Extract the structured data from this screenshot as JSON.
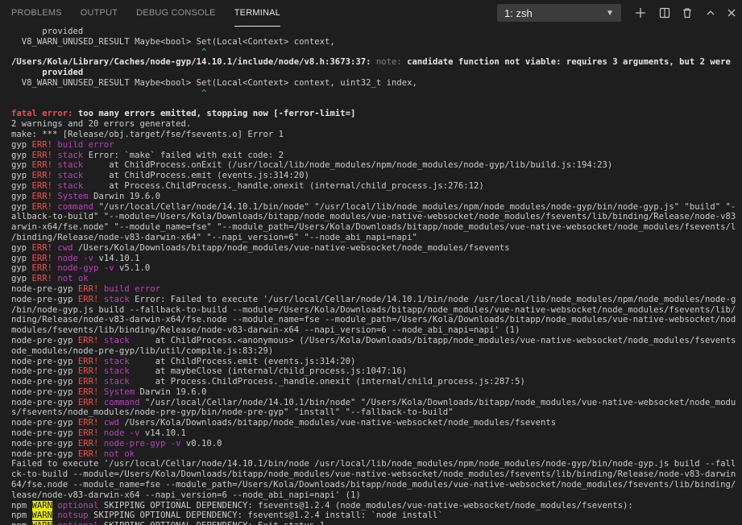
{
  "panel": {
    "tabs": [
      "PROBLEMS",
      "OUTPUT",
      "DEBUG CONSOLE",
      "TERMINAL"
    ],
    "active_tab": "TERMINAL",
    "terminal_select": "1: zsh",
    "icons": [
      "plus-icon",
      "split-icon",
      "trash-icon",
      "chevron-up-icon",
      "close-icon"
    ]
  },
  "terminal": {
    "lines": [
      [
        [
          "      provided"
        ]
      ],
      [
        [
          "  V8_WARN_UNUSED_RESULT Maybe<bool> Set(Local<Context> context,"
        ]
      ],
      [
        [
          "                                     ^",
          "grn"
        ]
      ],
      [
        [
          "/Users/Kola/Library/Caches/node-gyp/14.10.1/include/node/v8.h:3673:37: ",
          "b"
        ],
        [
          "note: ",
          "gry"
        ],
        [
          "candidate function not viable: requires 3 arguments, but 2 were",
          "b"
        ]
      ],
      [
        [
          "      provided",
          "b"
        ]
      ],
      [
        [
          "  V8_WARN_UNUSED_RESULT Maybe<bool> Set(Local<Context> context, uint32_t index,"
        ]
      ],
      [
        [
          "                                     ^",
          "grn"
        ]
      ],
      [
        [
          ""
        ]
      ],
      [
        [
          "fatal error: ",
          "red"
        ],
        [
          "too many errors emitted, stopping now [-ferror-limit=]",
          "b"
        ]
      ],
      [
        [
          "2 warnings and 20 errors generated."
        ]
      ],
      [
        [
          "make: *** [Release/obj.target/fse/fsevents.o] Error 1"
        ]
      ],
      [
        [
          "gyp "
        ],
        [
          "ERR!",
          "err"
        ],
        [
          " build error",
          "mag"
        ]
      ],
      [
        [
          "gyp "
        ],
        [
          "ERR!",
          "err"
        ],
        [
          " stack",
          "mag"
        ],
        [
          " Error: `make` failed with exit code: 2"
        ]
      ],
      [
        [
          "gyp "
        ],
        [
          "ERR!",
          "err"
        ],
        [
          " stack",
          "mag"
        ],
        [
          "     at ChildProcess.onExit (/usr/local/lib/node_modules/npm/node_modules/node-gyp/lib/build.js:194:23)"
        ]
      ],
      [
        [
          "gyp "
        ],
        [
          "ERR!",
          "err"
        ],
        [
          " stack",
          "mag"
        ],
        [
          "     at ChildProcess.emit (events.js:314:20)"
        ]
      ],
      [
        [
          "gyp "
        ],
        [
          "ERR!",
          "err"
        ],
        [
          " stack",
          "mag"
        ],
        [
          "     at Process.ChildProcess._handle.onexit (internal/child_process.js:276:12)"
        ]
      ],
      [
        [
          "gyp "
        ],
        [
          "ERR!",
          "err"
        ],
        [
          " System",
          "mag"
        ],
        [
          " Darwin 19.6.0"
        ]
      ],
      [
        [
          "gyp "
        ],
        [
          "ERR!",
          "err"
        ],
        [
          " command",
          "mag"
        ],
        [
          " \"/usr/local/Cellar/node/14.10.1/bin/node\" \"/usr/local/lib/node_modules/npm/node_modules/node-gyp/bin/node-gyp.js\" \"build\" \"--f"
        ]
      ],
      [
        [
          "allback-to-build\" \"--module=/Users/Kola/Downloads/bitapp/node_modules/vue-native-websocket/node_modules/fsevents/lib/binding/Release/node-v83-d"
        ]
      ],
      [
        [
          "arwin-x64/fse.node\" \"--module_name=fse\" \"--module_path=/Users/Kola/Downloads/bitapp/node_modules/vue-native-websocket/node_modules/fsevents/lib"
        ]
      ],
      [
        [
          "/binding/Release/node-v83-darwin-x64\" \"--napi_version=6\" \"--node_abi_napi=napi\""
        ]
      ],
      [
        [
          "gyp "
        ],
        [
          "ERR!",
          "err"
        ],
        [
          " cwd",
          "mag"
        ],
        [
          " /Users/Kola/Downloads/bitapp/node_modules/vue-native-websocket/node_modules/fsevents"
        ]
      ],
      [
        [
          "gyp "
        ],
        [
          "ERR!",
          "err"
        ],
        [
          " node -v",
          "mag"
        ],
        [
          " v14.10.1"
        ]
      ],
      [
        [
          "gyp "
        ],
        [
          "ERR!",
          "err"
        ],
        [
          " node-gyp -v",
          "mag"
        ],
        [
          " v5.1.0"
        ]
      ],
      [
        [
          "gyp "
        ],
        [
          "ERR!",
          "err"
        ],
        [
          " not ok",
          "mag"
        ]
      ],
      [
        [
          "node-pre-gyp "
        ],
        [
          "ERR!",
          "err"
        ],
        [
          " build error",
          "mag"
        ]
      ],
      [
        [
          "node-pre-gyp "
        ],
        [
          "ERR!",
          "err"
        ],
        [
          " stack",
          "mag"
        ],
        [
          " Error: Failed to execute '/usr/local/Cellar/node/14.10.1/bin/node /usr/local/lib/node_modules/npm/node_modules/node-gyp"
        ]
      ],
      [
        [
          "/bin/node-gyp.js build --fallback-to-build --module=/Users/Kola/Downloads/bitapp/node_modules/vue-native-websocket/node_modules/fsevents/lib/bi"
        ]
      ],
      [
        [
          "nding/Release/node-v83-darwin-x64/fse.node --module_name=fse --module_path=/Users/Kola/Downloads/bitapp/node_modules/vue-native-websocket/node_"
        ]
      ],
      [
        [
          "modules/fsevents/lib/binding/Release/node-v83-darwin-x64 --napi_version=6 --node_abi_napi=napi' (1)"
        ]
      ],
      [
        [
          "node-pre-gyp "
        ],
        [
          "ERR!",
          "err"
        ],
        [
          " stack",
          "mag"
        ],
        [
          "     at ChildProcess.<anonymous> (/Users/Kola/Downloads/bitapp/node_modules/vue-native-websocket/node_modules/fsevents/n"
        ]
      ],
      [
        [
          "ode_modules/node-pre-gyp/lib/util/compile.js:83:29)"
        ]
      ],
      [
        [
          "node-pre-gyp "
        ],
        [
          "ERR!",
          "err"
        ],
        [
          " stack",
          "mag"
        ],
        [
          "     at ChildProcess.emit (events.js:314:20)"
        ]
      ],
      [
        [
          "node-pre-gyp "
        ],
        [
          "ERR!",
          "err"
        ],
        [
          " stack",
          "mag"
        ],
        [
          "     at maybeClose (internal/child_process.js:1047:16)"
        ]
      ],
      [
        [
          "node-pre-gyp "
        ],
        [
          "ERR!",
          "err"
        ],
        [
          " stack",
          "mag"
        ],
        [
          "     at Process.ChildProcess._handle.onexit (internal/child_process.js:287:5)"
        ]
      ],
      [
        [
          "node-pre-gyp "
        ],
        [
          "ERR!",
          "err"
        ],
        [
          " System",
          "mag"
        ],
        [
          " Darwin 19.6.0"
        ]
      ],
      [
        [
          "node-pre-gyp "
        ],
        [
          "ERR!",
          "err"
        ],
        [
          " command",
          "mag"
        ],
        [
          " \"/usr/local/Cellar/node/14.10.1/bin/node\" \"/Users/Kola/Downloads/bitapp/node_modules/vue-native-websocket/node_module"
        ]
      ],
      [
        [
          "s/fsevents/node_modules/node-pre-gyp/bin/node-pre-gyp\" \"install\" \"--fallback-to-build\""
        ]
      ],
      [
        [
          "node-pre-gyp "
        ],
        [
          "ERR!",
          "err"
        ],
        [
          " cwd",
          "mag"
        ],
        [
          " /Users/Kola/Downloads/bitapp/node_modules/vue-native-websocket/node_modules/fsevents"
        ]
      ],
      [
        [
          "node-pre-gyp "
        ],
        [
          "ERR!",
          "err"
        ],
        [
          " node -v",
          "mag"
        ],
        [
          " v14.10.1"
        ]
      ],
      [
        [
          "node-pre-gyp "
        ],
        [
          "ERR!",
          "err"
        ],
        [
          " node-pre-gyp -v",
          "mag"
        ],
        [
          " v0.10.0"
        ]
      ],
      [
        [
          "node-pre-gyp "
        ],
        [
          "ERR!",
          "err"
        ],
        [
          " not ok",
          "mag"
        ]
      ],
      [
        [
          "Failed to execute '/usr/local/Cellar/node/14.10.1/bin/node /usr/local/lib/node_modules/npm/node_modules/node-gyp/bin/node-gyp.js build --fallba"
        ]
      ],
      [
        [
          "ck-to-build --module=/Users/Kola/Downloads/bitapp/node_modules/vue-native-websocket/node_modules/fsevents/lib/binding/Release/node-v83-darwin-x"
        ]
      ],
      [
        [
          "64/fse.node --module_name=fse --module_path=/Users/Kola/Downloads/bitapp/node_modules/vue-native-websocket/node_modules/fsevents/lib/binding/Re"
        ]
      ],
      [
        [
          "lease/node-v83-darwin-x64 --napi_version=6 --node_abi_napi=napi' (1)"
        ]
      ],
      [
        [
          "npm "
        ],
        [
          "WARN",
          "warn"
        ],
        [
          " optional",
          "mag"
        ],
        [
          " SKIPPING OPTIONAL DEPENDENCY: fsevents@1.2.4 (node_modules/vue-native-websocket/node_modules/fsevents):"
        ]
      ],
      [
        [
          "npm "
        ],
        [
          "WARN",
          "warn"
        ],
        [
          " notsup",
          "mag"
        ],
        [
          " SKIPPING OPTIONAL DEPENDENCY: fsevents@1.2.4 install: `node install`"
        ]
      ],
      [
        [
          "npm "
        ],
        [
          "WARN",
          "warn"
        ],
        [
          " optional",
          "mag"
        ],
        [
          " SKIPPING OPTIONAL DEPENDENCY: Exit status 1"
        ]
      ]
    ]
  }
}
